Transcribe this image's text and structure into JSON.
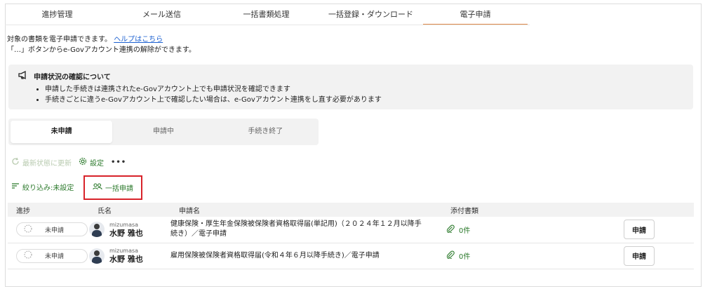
{
  "nav": {
    "tabs": [
      "進捗管理",
      "メール送信",
      "一括書類処理",
      "一括登録・ダウンロード",
      "電子申請"
    ],
    "active_index": 4
  },
  "intro": {
    "line1": "対象の書類を電子申請できます。",
    "help_link": "ヘルプはこちら",
    "line2": "「…」ボタンからe-Govアカウント連携の解除ができます。"
  },
  "notice": {
    "title": "申請状況の確認について",
    "items": [
      "申請した手続きは連携されたe-Govアカウント上でも申請状況を確認できます",
      "手続きごとに違うe-Govアカウント上で確認したい場合は、e-Govアカウント連携をし直す必要があります"
    ]
  },
  "segments": [
    "未申請",
    "申請中",
    "手続き終了"
  ],
  "actions": {
    "refresh": "最新状態に更新",
    "settings": "設定",
    "more": "•••"
  },
  "filter": {
    "label": "絞り込み:未設定",
    "bulk": "一括申請"
  },
  "table": {
    "headers": [
      "進捗",
      "氏名",
      "申請名",
      "添付書類"
    ],
    "rows": [
      {
        "status": "未申請",
        "user_sub": "mizumasa",
        "user_name": "水野 雅也",
        "app_name_1": "健康保険・厚生年金保険被保険者資格取得届(単記用)（２０２４年１２月以降手",
        "app_name_2": "続き）／電子申請",
        "attach": "0件",
        "button": "申請"
      },
      {
        "status": "未申請",
        "user_sub": "mizumasa",
        "user_name": "水野 雅也",
        "app_name_1": "雇用保険被保険者資格取得届(令和４年６月以降手続き)／電子申請",
        "app_name_2": "",
        "attach": "0件",
        "button": "申請"
      }
    ]
  },
  "colors": {
    "accent_green": "#2c7a2c",
    "active_tab_underline": "#e08a4a",
    "highlight_red": "#d8232a",
    "link_blue": "#1a5fd0"
  }
}
